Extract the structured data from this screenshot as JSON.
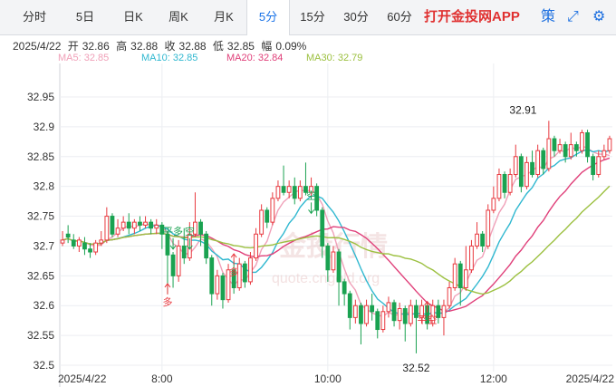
{
  "tabs": [
    {
      "label": "分时",
      "active": false
    },
    {
      "label": "5日",
      "active": false
    },
    {
      "label": "日K",
      "active": false
    },
    {
      "label": "周K",
      "active": false
    },
    {
      "label": "月K",
      "active": false
    },
    {
      "label": "5分",
      "active": true
    },
    {
      "label": "15分",
      "active": false
    },
    {
      "label": "30分",
      "active": false
    },
    {
      "label": "60分",
      "active": false
    }
  ],
  "app_link": "打开金投网APP",
  "toolbar_icons": [
    {
      "name": "strategy-icon",
      "glyph": "策"
    },
    {
      "name": "expand-icon",
      "glyph": "⤢"
    },
    {
      "name": "settings-icon",
      "glyph": "⚙"
    }
  ],
  "info": {
    "date": "2025/4/22",
    "open_label": "开",
    "open": "32.86",
    "high_label": "高",
    "high": "32.88",
    "close_label": "收",
    "close": "32.88",
    "low_label": "低",
    "low": "32.85",
    "change_label": "幅",
    "change": "0.09%"
  },
  "ma_legend": [
    {
      "label": "MA5: 32.85",
      "color": "#f0a0b8"
    },
    {
      "label": "MA10: 32.85",
      "color": "#30b8d0"
    },
    {
      "label": "MA20: 32.84",
      "color": "#e0407a"
    },
    {
      "label": "MA30: 32.79",
      "color": "#9cc040"
    }
  ],
  "watermark": {
    "cn": "金投行情",
    "en": "quote.cngold.org"
  },
  "colors": {
    "up": "#e8393f",
    "down": "#1aa251",
    "grid": "#eceef2"
  },
  "chart_data": {
    "type": "candlestick",
    "ylim": [
      32.5,
      32.95
    ],
    "y_ticks": [
      32.5,
      32.55,
      32.6,
      32.65,
      32.7,
      32.75,
      32.8,
      32.85,
      32.9,
      32.95
    ],
    "y_tick_labels": [
      "32.5",
      "32.55",
      "32.6",
      "32.65",
      "32.7",
      "32.75",
      "32.8",
      "32.85",
      "32.9",
      "32.95"
    ],
    "x_labels": [
      {
        "index": 0,
        "label": "2025/4/22"
      },
      {
        "index": 18,
        "label": "8:00"
      },
      {
        "index": 48,
        "label": "10:00"
      },
      {
        "index": 78,
        "label": "12:00"
      },
      {
        "index": 99,
        "label": "2025/4/22"
      }
    ],
    "candles": [
      [
        32.705,
        32.71,
        32.725,
        32.7
      ],
      [
        32.72,
        32.715,
        32.735,
        32.705
      ],
      [
        32.71,
        32.7,
        32.72,
        32.695
      ],
      [
        32.7,
        32.71,
        32.715,
        32.69
      ],
      [
        32.705,
        32.695,
        32.715,
        32.685
      ],
      [
        32.695,
        32.69,
        32.705,
        32.68
      ],
      [
        32.69,
        32.705,
        32.71,
        32.685
      ],
      [
        32.705,
        32.71,
        32.725,
        32.7
      ],
      [
        32.71,
        32.75,
        32.765,
        32.705
      ],
      [
        32.75,
        32.72,
        32.755,
        32.715
      ],
      [
        32.72,
        32.73,
        32.745,
        32.715
      ],
      [
        32.73,
        32.74,
        32.75,
        32.725
      ],
      [
        32.74,
        32.73,
        32.755,
        32.72
      ],
      [
        32.73,
        32.74,
        32.745,
        32.72
      ],
      [
        32.74,
        32.735,
        32.75,
        32.725
      ],
      [
        32.735,
        32.74,
        32.75,
        32.73
      ],
      [
        32.74,
        32.73,
        32.745,
        32.72
      ],
      [
        32.73,
        32.735,
        32.745,
        32.72
      ],
      [
        32.735,
        32.72,
        32.74,
        32.695
      ],
      [
        32.72,
        32.685,
        32.725,
        32.62
      ],
      [
        32.685,
        32.65,
        32.69,
        32.63
      ],
      [
        32.65,
        32.7,
        32.71,
        32.64
      ],
      [
        32.7,
        32.68,
        32.73,
        32.67
      ],
      [
        32.68,
        32.72,
        32.74,
        32.675
      ],
      [
        32.72,
        32.74,
        32.79,
        32.715
      ],
      [
        32.74,
        32.72,
        32.745,
        32.7
      ],
      [
        32.72,
        32.68,
        32.725,
        32.67
      ],
      [
        32.68,
        32.62,
        32.685,
        32.6
      ],
      [
        32.62,
        32.65,
        32.66,
        32.61
      ],
      [
        32.65,
        32.61,
        32.655,
        32.595
      ],
      [
        32.61,
        32.66,
        32.67,
        32.605
      ],
      [
        32.66,
        32.63,
        32.675,
        32.62
      ],
      [
        32.63,
        32.67,
        32.68,
        32.625
      ],
      [
        32.67,
        32.64,
        32.675,
        32.63
      ],
      [
        32.64,
        32.68,
        32.69,
        32.635
      ],
      [
        32.68,
        32.72,
        32.73,
        32.675
      ],
      [
        32.72,
        32.76,
        32.77,
        32.715
      ],
      [
        32.76,
        32.74,
        32.765,
        32.73
      ],
      [
        32.74,
        32.78,
        32.79,
        32.735
      ],
      [
        32.78,
        32.8,
        32.81,
        32.775
      ],
      [
        32.8,
        32.79,
        32.835,
        32.785
      ],
      [
        32.79,
        32.8,
        32.81,
        32.78
      ],
      [
        32.8,
        32.78,
        32.815,
        32.77
      ],
      [
        32.78,
        32.8,
        32.81,
        32.775
      ],
      [
        32.8,
        32.79,
        32.84,
        32.785
      ],
      [
        32.79,
        32.8,
        32.815,
        32.78
      ],
      [
        32.8,
        32.76,
        32.805,
        32.75
      ],
      [
        32.76,
        32.7,
        32.765,
        32.68
      ],
      [
        32.7,
        32.66,
        32.705,
        32.64
      ],
      [
        32.66,
        32.69,
        32.7,
        32.655
      ],
      [
        32.69,
        32.64,
        32.695,
        32.6
      ],
      [
        32.64,
        32.62,
        32.645,
        32.6
      ],
      [
        32.62,
        32.58,
        32.625,
        32.56
      ],
      [
        32.58,
        32.6,
        32.61,
        32.57
      ],
      [
        32.6,
        32.57,
        32.605,
        32.535
      ],
      [
        32.57,
        32.6,
        32.61,
        32.565
      ],
      [
        32.6,
        32.59,
        32.62,
        32.575
      ],
      [
        32.59,
        32.56,
        32.595,
        32.545
      ],
      [
        32.56,
        32.59,
        32.6,
        32.555
      ],
      [
        32.59,
        32.605,
        32.615,
        32.58
      ],
      [
        32.605,
        32.575,
        32.61,
        32.565
      ],
      [
        32.575,
        32.595,
        32.605,
        32.56
      ],
      [
        32.595,
        32.57,
        32.6,
        32.54
      ],
      [
        32.57,
        32.6,
        32.61,
        32.565
      ],
      [
        32.6,
        32.58,
        32.61,
        32.52
      ],
      [
        32.58,
        32.6,
        32.61,
        32.57
      ],
      [
        32.6,
        32.57,
        32.605,
        32.56
      ],
      [
        32.57,
        32.6,
        32.61,
        32.565
      ],
      [
        32.6,
        32.58,
        32.61,
        32.57
      ],
      [
        32.58,
        32.6,
        32.61,
        32.55
      ],
      [
        32.6,
        32.63,
        32.64,
        32.595
      ],
      [
        32.63,
        32.67,
        32.68,
        32.625
      ],
      [
        32.67,
        32.63,
        32.675,
        32.6
      ],
      [
        32.63,
        32.66,
        32.7,
        32.625
      ],
      [
        32.66,
        32.7,
        32.71,
        32.655
      ],
      [
        32.7,
        32.72,
        32.74,
        32.695
      ],
      [
        32.72,
        32.7,
        32.725,
        32.69
      ],
      [
        32.7,
        32.76,
        32.77,
        32.695
      ],
      [
        32.76,
        32.78,
        32.8,
        32.755
      ],
      [
        32.78,
        32.82,
        32.83,
        32.775
      ],
      [
        32.82,
        32.79,
        32.825,
        32.78
      ],
      [
        32.79,
        32.82,
        32.83,
        32.785
      ],
      [
        32.82,
        32.85,
        32.87,
        32.815
      ],
      [
        32.85,
        32.8,
        32.855,
        32.79
      ],
      [
        32.8,
        32.84,
        32.85,
        32.795
      ],
      [
        32.84,
        32.82,
        32.86,
        32.815
      ],
      [
        32.82,
        32.86,
        32.87,
        32.815
      ],
      [
        32.86,
        32.83,
        32.865,
        32.82
      ],
      [
        32.83,
        32.88,
        32.91,
        32.825
      ],
      [
        32.88,
        32.86,
        32.885,
        32.85
      ],
      [
        32.86,
        32.87,
        32.88,
        32.855
      ],
      [
        32.87,
        32.85,
        32.875,
        32.84
      ],
      [
        32.85,
        32.87,
        32.89,
        32.845
      ],
      [
        32.87,
        32.86,
        32.875,
        32.85
      ],
      [
        32.86,
        32.89,
        32.895,
        32.855
      ],
      [
        32.89,
        32.85,
        32.895,
        32.84
      ],
      [
        32.85,
        32.82,
        32.855,
        32.81
      ],
      [
        32.82,
        32.85,
        32.86,
        32.815
      ],
      [
        32.85,
        32.86,
        32.87,
        32.845
      ],
      [
        32.86,
        32.88,
        32.885,
        32.855
      ]
    ],
    "annotations": [
      {
        "index": 20,
        "price": 32.71,
        "text": "平多",
        "color": "#1aa251",
        "pos": "above"
      },
      {
        "index": 23,
        "price": 32.71,
        "text": "空",
        "color": "#1aa251",
        "pos": "above"
      },
      {
        "index": 19,
        "price": 32.64,
        "text": "多",
        "color": "#e8393f",
        "pos": "below"
      },
      {
        "index": 31,
        "price": 32.69,
        "text": "多",
        "color": "#e8393f",
        "pos": "below"
      },
      {
        "index": 45,
        "price": 32.77,
        "text": "空",
        "color": "#1aa251",
        "pos": "above"
      },
      {
        "index": 66,
        "price": 32.61,
        "text": "平空",
        "color": "#e8393f",
        "pos": "below"
      }
    ],
    "peak_label": {
      "index": 84,
      "price": 32.91,
      "text": "32.91"
    },
    "trough_label": {
      "index": 64,
      "price": 32.52,
      "text": "32.52"
    }
  }
}
